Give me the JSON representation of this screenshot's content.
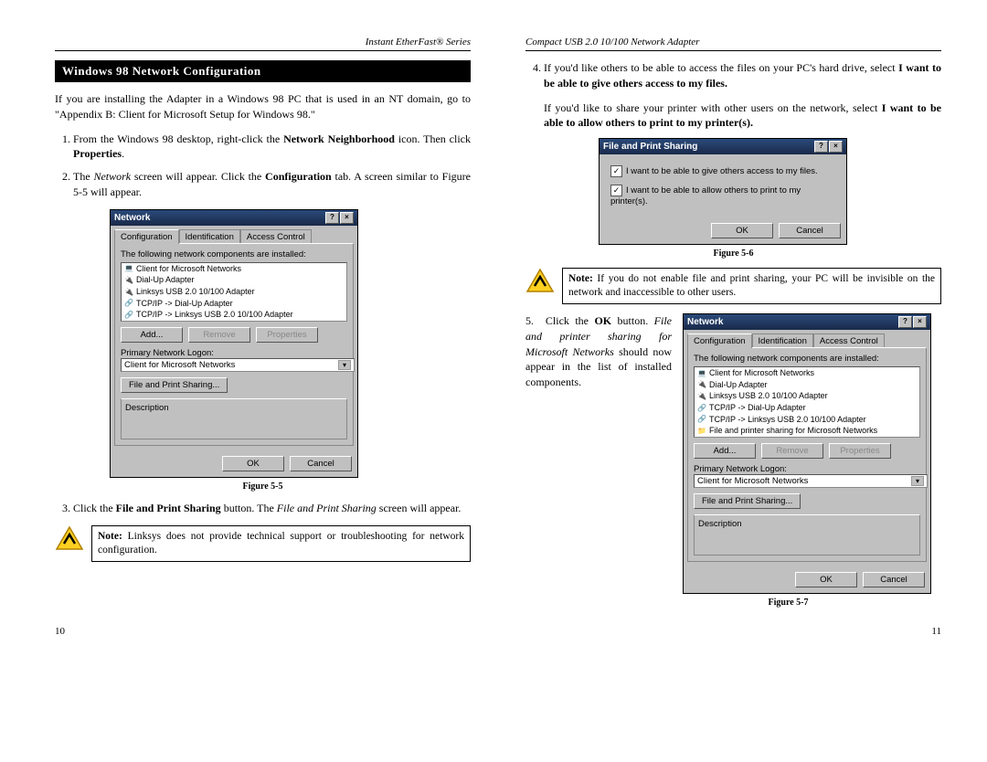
{
  "headers": {
    "left": "Instant EtherFast® Series",
    "right": "Compact USB 2.0 10/100 Network Adapter"
  },
  "section_title": "Windows 98 Network Configuration",
  "intro": "If you are installing the Adapter in a Windows 98 PC that is used in an NT domain, go to \"Appendix B: Client for Microsoft Setup for Windows 98.\"",
  "step1a": "From the Windows 98 desktop, right-click the ",
  "step1b": "Network Neighborhood",
  "step1c": " icon. Then click ",
  "step1d": "Properties",
  "step1e": ".",
  "step2a": "The ",
  "step2b": "Network",
  "step2c": " screen will appear. Click the ",
  "step2d": "Configuration",
  "step2e": " tab. A screen similar to Figure 5-5 will appear.",
  "step3a": "Click the ",
  "step3b": "File and Print Sharing",
  "step3c": " button. The ",
  "step3d": "File and Print Sharing",
  "step3e": " screen will appear.",
  "step4a": "If you'd like others to be able to access the files on your PC's hard drive, select ",
  "step4b": "I want to be able to give others access to my files.",
  "step4c": "If you'd like to share your printer with other users on the network, select ",
  "step4d": "I want to be able to allow others to print to my printer(s).",
  "step5a": "Click the ",
  "step5b": "OK",
  "step5c": " button. ",
  "step5d": "File and printer sharing for Microsoft Networks",
  "step5e": " should now appear in the list of installed components.",
  "note1a": "Note:",
  "note1b": " Linksys does not provide technical support or troubleshooting for network configuration.",
  "note2a": "Note:",
  "note2b": " If you do not enable file and print sharing, your PC will be invisible on the network and inaccessible to other users.",
  "dlg": {
    "title": "Network",
    "tab1": "Configuration",
    "tab2": "Identification",
    "tab3": "Access Control",
    "list_label": "The following network components are installed:",
    "items5": [
      "Client for Microsoft Networks",
      "Dial-Up Adapter",
      "Linksys USB 2.0 10/100 Adapter",
      "TCP/IP -> Dial-Up Adapter",
      "TCP/IP -> Linksys USB 2.0 10/100 Adapter"
    ],
    "items7": [
      "Client for Microsoft Networks",
      "Dial-Up Adapter",
      "Linksys USB 2.0 10/100 Adapter",
      "TCP/IP -> Dial-Up Adapter",
      "TCP/IP -> Linksys USB 2.0 10/100 Adapter",
      "File and printer sharing for Microsoft Networks"
    ],
    "add": "Add...",
    "remove": "Remove",
    "properties": "Properties",
    "logon_label": "Primary Network Logon:",
    "logon_value": "Client for Microsoft Networks",
    "fps": "File and Print Sharing...",
    "desc": "Description",
    "ok": "OK",
    "cancel": "Cancel"
  },
  "fps_dlg": {
    "title": "File and Print Sharing",
    "chk1": "I want to be able to give others access to my files.",
    "chk2": "I want to be able to allow others to print to my printer(s)."
  },
  "figcap5": "Figure 5-5",
  "figcap6": "Figure 5-6",
  "figcap7": "Figure 5-7",
  "page_left": "10",
  "page_right": "11"
}
